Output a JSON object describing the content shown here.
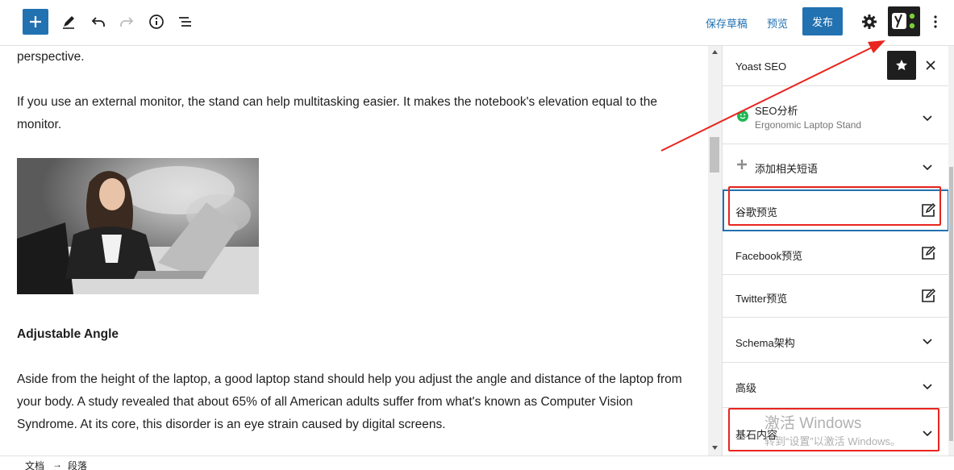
{
  "toolbar": {
    "save_draft": "保存草稿",
    "preview": "预览",
    "publish": "发布",
    "accent_color": "#2271b1"
  },
  "editor": {
    "paragraphs": [
      "perspective.",
      "If you use an external monitor, the stand can help multitasking easier. It makes the notebook's elevation equal to the monitor.",
      "Aside from the height of the laptop, a good laptop stand should help you adjust the angle and distance of the laptop from your body. A study revealed that about 65% of all American adults suffer from what's known as Computer Vision Syndrome. At its core, this disorder is an eye strain caused by digital screens."
    ],
    "heading": "Adjustable Angle"
  },
  "sidebar": {
    "title": "Yoast SEO",
    "seo_analysis": {
      "label": "SEO分析",
      "keyphrase": "Ergonomic Laptop Stand",
      "status_color": "#1db954"
    },
    "panels": [
      {
        "label": "添加相关短语",
        "icon": "plus-icon"
      },
      {
        "label": "谷歌预览",
        "icon": "edit-icon"
      },
      {
        "label": "Facebook预览",
        "icon": "edit-icon"
      },
      {
        "label": "Twitter预览",
        "icon": "edit-icon"
      },
      {
        "label": "Schema架构",
        "icon": "chevron-down-icon"
      },
      {
        "label": "高级",
        "icon": "chevron-down-icon"
      },
      {
        "label": "基石内容",
        "icon": "chevron-down-icon"
      }
    ]
  },
  "footer": {
    "breadcrumb": [
      "文档",
      "→",
      "段落"
    ]
  },
  "watermark": {
    "line1": "激活 Windows",
    "line2": "转到“设置”以激活 Windows。"
  }
}
